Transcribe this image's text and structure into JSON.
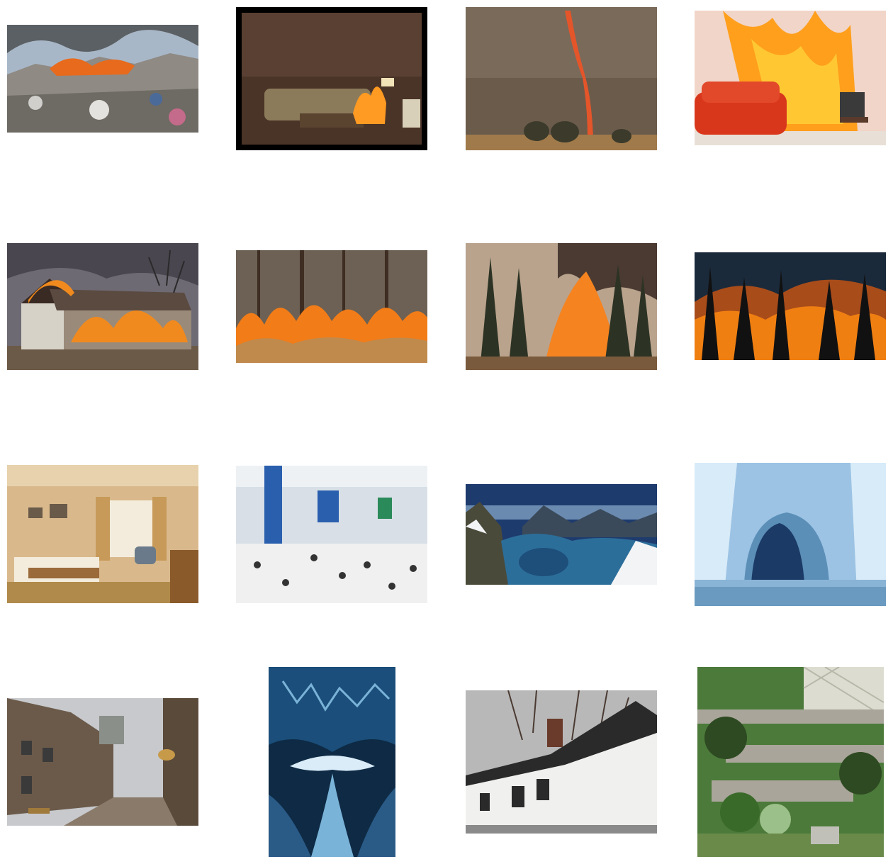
{
  "grid": {
    "rows": 4,
    "columns": 4,
    "background": "#ffffff"
  },
  "images": [
    {
      "subject": "burning-garbage-dump",
      "palette": [
        "#a8b7c7",
        "#2f2f2f",
        "#e86a1c",
        "#8f8a84"
      ]
    },
    {
      "subject": "living-room-sofa-fire",
      "palette": [
        "#000000",
        "#4a3327",
        "#ff9a22",
        "#8b7b5a"
      ]
    },
    {
      "subject": "fire-tornado-savanna",
      "palette": [
        "#6b5b4b",
        "#e5552a",
        "#3b3a2b",
        "#a07a4a"
      ]
    },
    {
      "subject": "red-sofa-christmas-tree-fire",
      "palette": [
        "#f1d5c8",
        "#d9371c",
        "#ff9f1c",
        "#5a3a2a"
      ]
    },
    {
      "subject": "burning-wooden-house",
      "palette": [
        "#6e6a73",
        "#f08a1e",
        "#d7d2c8",
        "#6b5a47"
      ]
    },
    {
      "subject": "forest-floor-fire",
      "palette": [
        "#6c6154",
        "#f27c18",
        "#3e2d22",
        "#c08a4d"
      ]
    },
    {
      "subject": "pine-forest-fire",
      "palette": [
        "#b9a38d",
        "#f58320",
        "#2d3324",
        "#7a5a3c"
      ]
    },
    {
      "subject": "forest-fire-silhouette-trees",
      "palette": [
        "#1b2a3b",
        "#f07f12",
        "#111111",
        "#a84c1a"
      ]
    },
    {
      "subject": "hotel-bedroom",
      "palette": [
        "#d9b98c",
        "#f3ecdc",
        "#9a6a3a",
        "#6a7a8a"
      ]
    },
    {
      "subject": "airport-terminal-crowd",
      "palette": [
        "#d8dfe6",
        "#2a5fae",
        "#f0f0f0",
        "#333333"
      ]
    },
    {
      "subject": "fjord-mountain-landscape",
      "palette": [
        "#1e3b6e",
        "#f2f4f6",
        "#2c6e9a",
        "#4a4a3a"
      ]
    },
    {
      "subject": "glacier-ice-cave",
      "palette": [
        "#9cc3e4",
        "#1c3a66",
        "#d8ebf8",
        "#5b8fb8"
      ]
    },
    {
      "subject": "old-town-cobblestone-street",
      "palette": [
        "#c7c9cc",
        "#6b5a4a",
        "#8a8f8a",
        "#c79a4a"
      ]
    },
    {
      "subject": "blue-ice-cave-stream",
      "palette": [
        "#0e2a44",
        "#7ab3d8",
        "#d9ecf8",
        "#1b4e7a"
      ]
    },
    {
      "subject": "white-house-bare-trees",
      "palette": [
        "#b8b8b8",
        "#f0f0ee",
        "#4a3a32",
        "#2a2a2a"
      ]
    },
    {
      "subject": "terraced-stone-garden",
      "palette": [
        "#4c7a3a",
        "#a9a59a",
        "#dcdcd0",
        "#2e4a22"
      ]
    }
  ]
}
